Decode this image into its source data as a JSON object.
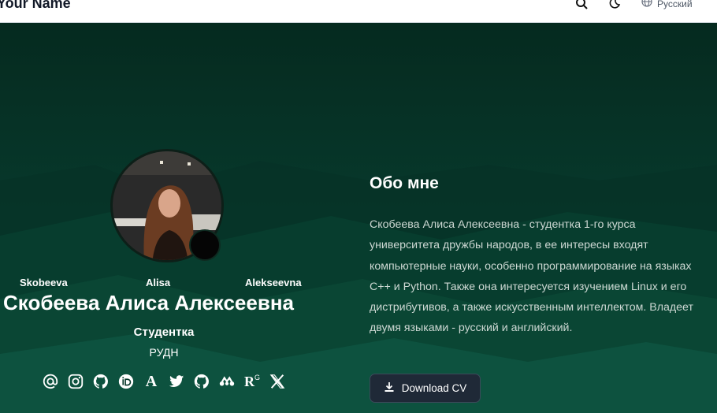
{
  "navbar": {
    "brand": "Your Name",
    "language": "Русский",
    "icons": [
      "search-icon",
      "moon-icon",
      "globe-icon"
    ]
  },
  "profile": {
    "name_parts": [
      "Skobeeva",
      "Alisa",
      "Alekseevna"
    ],
    "full_name": "Скобеева Алиса Алексеевна",
    "role": "Студентка",
    "organization": "РУДН",
    "socials": [
      "email-icon",
      "instagram-icon",
      "github-icon",
      "orcid-icon",
      "academia-icon",
      "twitter-icon",
      "github-alt-icon",
      "mendeley-icon",
      "researchgate-icon",
      "x-icon"
    ],
    "social_text": {
      "academia": "A",
      "researchgate": "R"
    }
  },
  "about": {
    "title": "Обо мне",
    "text": "Скобеева Алиса Алексеевна - студентка 1-го курса университета дружбы народов, в ее интересы входят компьютерные науки, особенно программирование на языках C++ и Python. Также она интересуется изучением Linux и его дистрибутивов, а также искусственным интеллектом. Владеет двумя языками - русский и английский.",
    "cv_label": "Download CV"
  },
  "colors": {
    "hero_bg": "#07372a",
    "button_bg": "#1f2937",
    "text_muted": "#cdd8d3"
  }
}
